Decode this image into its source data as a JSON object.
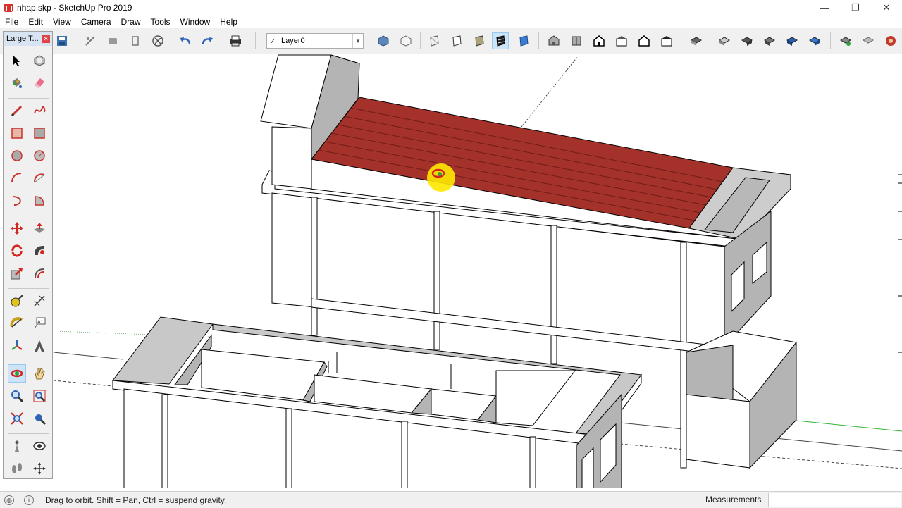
{
  "window": {
    "title": "nhap.skp - SketchUp Pro 2019",
    "minimize": "—",
    "restore": "❐",
    "close": "✕"
  },
  "menu": [
    "File",
    "Edit",
    "View",
    "Camera",
    "Draw",
    "Tools",
    "Window",
    "Help"
  ],
  "layer": {
    "current": "Layer0",
    "check": "✓"
  },
  "panel": {
    "title": "Large T...",
    "close": "✕"
  },
  "status": {
    "hint": "Drag to orbit. Shift = Pan, Ctrl = suspend gravity.",
    "measurements_label": "Measurements",
    "measurements_value": ""
  },
  "colors": {
    "roof": "#a4322a",
    "wall_gray": "#b4b4b4",
    "selection": "#cce4f7",
    "axis_green": "#33b533",
    "cursor_highlight": "#ffe800"
  },
  "icons": {
    "toolbar": [
      "make-component-icon",
      "erase-icon",
      "paint-icon",
      "dark-component-icon",
      "circle-x-icon",
      "undo-icon",
      "redo-icon",
      "print-icon",
      "shaded-icon",
      "wireframe-box-icon",
      "xray-icon",
      "hidden-line-icon",
      "shaded-face-icon",
      "textured-shaded-icon",
      "monochrome-icon",
      "iso-view-icon",
      "top-view-icon",
      "front-view-icon",
      "right-view-icon",
      "back-view-icon",
      "left-view-icon",
      "section-plane-icon",
      "section-display-icon",
      "section-cut-icon",
      "section-fill-icon",
      "section-fill-2-icon",
      "section-fill-3-icon",
      "warehouse-icon",
      "extension-icon",
      "ruby-icon"
    ],
    "tools": [
      "select-icon",
      "component-icon",
      "paint-bucket-icon",
      "eraser-icon",
      "pencil-line-icon",
      "freehand-icon",
      "rectangle-icon",
      "rotated-rectangle-icon",
      "circle-icon",
      "polygon-icon",
      "arc-icon",
      "two-point-arc-icon",
      "three-point-arc-icon",
      "pie-icon",
      "move-icon",
      "push-pull-icon",
      "rotate-icon",
      "follow-me-icon",
      "scale-icon",
      "offset-icon",
      "tape-measure-icon",
      "dimension-icon",
      "protractor-icon",
      "text-icon",
      "axes-icon",
      "3d-text-icon",
      "orbit-icon",
      "pan-icon",
      "zoom-icon",
      "zoom-window-icon",
      "zoom-extents-icon",
      "zoom-previous-icon",
      "position-camera-icon",
      "look-around-icon",
      "walk-icon",
      "section-plane-tool-icon"
    ]
  }
}
